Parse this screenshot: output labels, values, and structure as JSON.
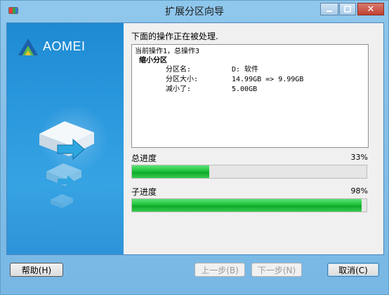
{
  "window": {
    "title": "扩展分区向导",
    "close_glyph": "✕"
  },
  "sidebar": {
    "brand": "AOMEI"
  },
  "main": {
    "heading": "下面的操作正在被处理.",
    "log": {
      "line1": "当前操作1，总操作3",
      "title": "缩小分区",
      "rows": [
        {
          "key": "分区名:",
          "value": "D: 软件"
        },
        {
          "key": "分区大小:",
          "value": "14.99GB => 9.99GB"
        },
        {
          "key": "减小了:",
          "value": "5.00GB"
        }
      ]
    },
    "total_progress": {
      "label": "总进度",
      "percent_text": "33%",
      "value": 0.33
    },
    "sub_progress": {
      "label": "子进度",
      "percent_text": "98%",
      "value": 0.98
    }
  },
  "footer": {
    "help_label": "帮助(H)",
    "prev_label": "上一步(B)",
    "next_label": "下一步(N)",
    "cancel_label": "取消(C)"
  },
  "colors": {
    "progress_green": "#1ec33a",
    "sidebar_blue": "#2a97dd",
    "title_bar": "#8fc7ec"
  }
}
